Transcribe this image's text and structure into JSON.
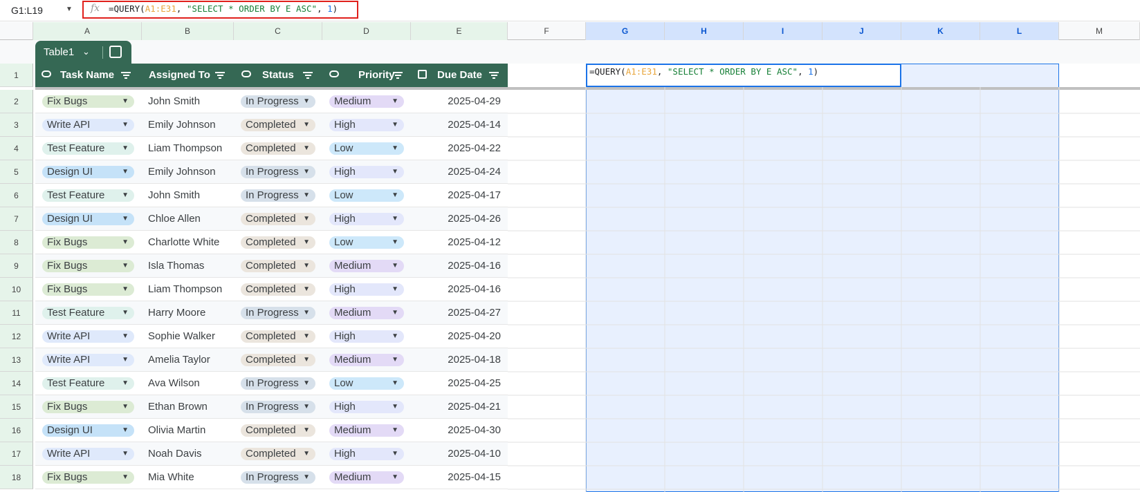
{
  "name_box": "G1:L19",
  "formula": {
    "fx": "fx",
    "parts": [
      "=QUERY(",
      "A1:E31",
      ", ",
      "\"SELECT * ORDER BY E ASC\"",
      ", ",
      "1",
      ")"
    ]
  },
  "columns": [
    "A",
    "B",
    "C",
    "D",
    "E",
    "F",
    "G",
    "H",
    "I",
    "J",
    "K",
    "L",
    "M"
  ],
  "table": {
    "name": "Table1",
    "headers": [
      "Task Name",
      "Assigned To",
      "Status",
      "Priority",
      "Due Date"
    ],
    "rows": [
      {
        "n": "2",
        "task": "Fix Bugs",
        "assigned": "John Smith",
        "status": "In Progress",
        "priority": "Medium",
        "due": "2025-04-29"
      },
      {
        "n": "3",
        "task": "Write API",
        "assigned": "Emily Johnson",
        "status": "Completed",
        "priority": "High",
        "due": "2025-04-14"
      },
      {
        "n": "4",
        "task": "Test Feature",
        "assigned": "Liam Thompson",
        "status": "Completed",
        "priority": "Low",
        "due": "2025-04-22"
      },
      {
        "n": "5",
        "task": "Design UI",
        "assigned": "Emily Johnson",
        "status": "In Progress",
        "priority": "High",
        "due": "2025-04-24"
      },
      {
        "n": "6",
        "task": "Test Feature",
        "assigned": "John Smith",
        "status": "In Progress",
        "priority": "Low",
        "due": "2025-04-17"
      },
      {
        "n": "7",
        "task": "Design UI",
        "assigned": "Chloe Allen",
        "status": "Completed",
        "priority": "High",
        "due": "2025-04-26"
      },
      {
        "n": "8",
        "task": "Fix Bugs",
        "assigned": "Charlotte White",
        "status": "Completed",
        "priority": "Low",
        "due": "2025-04-12"
      },
      {
        "n": "9",
        "task": "Fix Bugs",
        "assigned": "Isla Thomas",
        "status": "Completed",
        "priority": "Medium",
        "due": "2025-04-16"
      },
      {
        "n": "10",
        "task": "Fix Bugs",
        "assigned": "Liam Thompson",
        "status": "Completed",
        "priority": "High",
        "due": "2025-04-16"
      },
      {
        "n": "11",
        "task": "Test Feature",
        "assigned": "Harry Moore",
        "status": "In Progress",
        "priority": "Medium",
        "due": "2025-04-27"
      },
      {
        "n": "12",
        "task": "Write API",
        "assigned": "Sophie Walker",
        "status": "Completed",
        "priority": "High",
        "due": "2025-04-20"
      },
      {
        "n": "13",
        "task": "Write API",
        "assigned": "Amelia Taylor",
        "status": "Completed",
        "priority": "Medium",
        "due": "2025-04-18"
      },
      {
        "n": "14",
        "task": "Test Feature",
        "assigned": "Ava Wilson",
        "status": "In Progress",
        "priority": "Low",
        "due": "2025-04-25"
      },
      {
        "n": "15",
        "task": "Fix Bugs",
        "assigned": "Ethan Brown",
        "status": "In Progress",
        "priority": "High",
        "due": "2025-04-21"
      },
      {
        "n": "16",
        "task": "Design UI",
        "assigned": "Olivia Martin",
        "status": "Completed",
        "priority": "Medium",
        "due": "2025-04-30"
      },
      {
        "n": "17",
        "task": "Write API",
        "assigned": "Noah Davis",
        "status": "Completed",
        "priority": "High",
        "due": "2025-04-10"
      },
      {
        "n": "18",
        "task": "Fix Bugs",
        "assigned": "Mia White",
        "status": "In Progress",
        "priority": "Medium",
        "due": "2025-04-15"
      }
    ]
  },
  "chip_colors": {
    "Fix Bugs": "#dcebd4",
    "Write API": "#dfe9fb",
    "Test Feature": "#dff1ec",
    "Design UI": "#c5e2f8",
    "In Progress": "#d6e0ea",
    "Completed": "#ebe5dd",
    "Medium": "#e3daf6",
    "High": "#e3e7fb",
    "Low": "#cde8fa"
  },
  "header_row_number": "1"
}
